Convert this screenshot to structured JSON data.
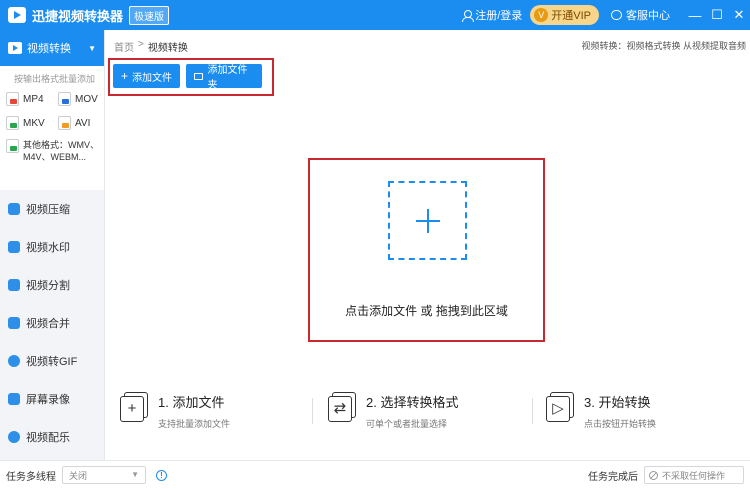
{
  "titlebar": {
    "app_title": "迅捷视频转换器",
    "edition_badge": "极速版",
    "login_label": "注册/登录",
    "vip_label": "开通VIP",
    "service_label": "客服中心",
    "min_glyph": "—",
    "max_glyph": "☐",
    "close_glyph": "✕"
  },
  "sidebar": {
    "active_item": "视频转换",
    "format_hint": "按输出格式批量添加",
    "formats": [
      {
        "label": "MP4",
        "icon": "mp4-file-icon",
        "color": "#e5483b"
      },
      {
        "label": "MOV",
        "icon": "mov-file-icon",
        "color": "#2a6fd6"
      },
      {
        "label": "MKV",
        "icon": "mkv-file-icon",
        "color": "#2aa64c"
      },
      {
        "label": "AVI",
        "icon": "avi-file-icon",
        "color": "#f29b22"
      }
    ],
    "other_formats_line1": "其他格式：WMV、",
    "other_formats_line2": "M4V、WEBM...",
    "items": [
      {
        "label": "视频压缩",
        "icon": "video-compress-icon"
      },
      {
        "label": "视频水印",
        "icon": "video-watermark-icon"
      },
      {
        "label": "视频分割",
        "icon": "video-split-icon"
      },
      {
        "label": "视频合并",
        "icon": "video-merge-icon"
      },
      {
        "label": "视频转GIF",
        "icon": "video-gif-icon"
      },
      {
        "label": "屏幕录像",
        "icon": "screen-record-icon"
      },
      {
        "label": "视频配乐",
        "icon": "video-music-icon"
      }
    ]
  },
  "breadcrumb": {
    "home": "首页",
    "sep": ">",
    "current": "视频转换"
  },
  "sub_hint": "视频转换：视频格式转换 从视频提取音频",
  "toolbar": {
    "add_file": "添加文件",
    "add_folder": "添加文件夹"
  },
  "drop_zone": {
    "text": "点击添加文件 或 拖拽到此区域"
  },
  "steps": [
    {
      "title": "1. 添加文件",
      "sub": "支持批量添加文件",
      "icon": "add-file-step-icon",
      "sym": "+"
    },
    {
      "title": "2. 选择转换格式",
      "sub": "可单个或者批量选择",
      "icon": "select-format-step-icon",
      "sym": "⇄"
    },
    {
      "title": "3. 开始转换",
      "sub": "点击按钮开始转换",
      "icon": "start-convert-step-icon",
      "sym": "▷"
    }
  ],
  "statusbar": {
    "threads_label": "任务多线程",
    "threads_value": "关闭",
    "after_label": "任务完成后",
    "after_value": "不采取任何操作"
  },
  "colors": {
    "accent": "#1b8cf0",
    "highlight_box": "#c8282e"
  }
}
